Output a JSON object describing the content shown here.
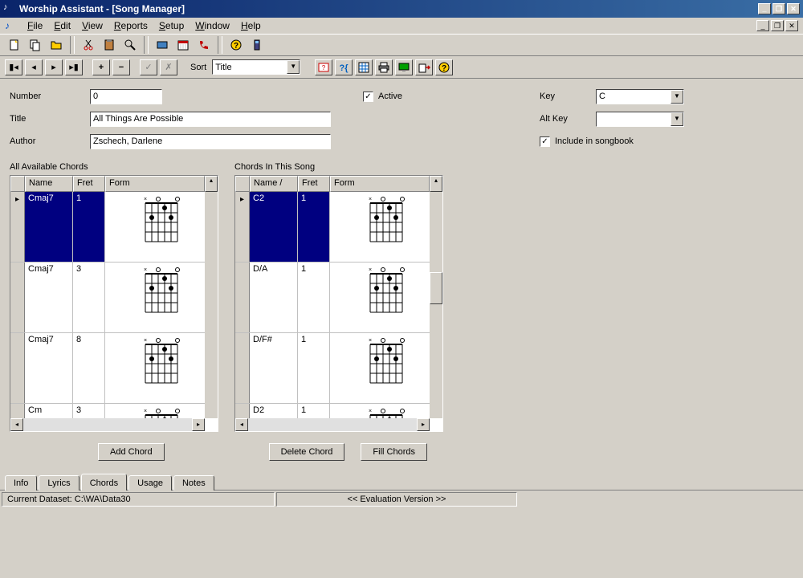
{
  "window": {
    "title": "Worship Assistant - [Song Manager]"
  },
  "menu": {
    "file": "File",
    "edit": "Edit",
    "view": "View",
    "reports": "Reports",
    "setup": "Setup",
    "window": "Window",
    "help": "Help"
  },
  "nav": {
    "sort_label": "Sort",
    "sort_value": "Title"
  },
  "form": {
    "number_label": "Number",
    "number_value": "0",
    "title_label": "Title",
    "title_value": "All Things Are Possible",
    "author_label": "Author",
    "author_value": "Zschech, Darlene",
    "active_label": "Active",
    "active_checked": true,
    "key_label": "Key",
    "key_value": "C",
    "altkey_label": "Alt Key",
    "altkey_value": "",
    "include_label": "Include in songbook",
    "include_checked": true
  },
  "left_panel": {
    "title": "All Available Chords",
    "headers": {
      "name": "Name",
      "fret": "Fret",
      "form": "Form"
    },
    "rows": [
      {
        "name": "Cmaj7",
        "fret": "1",
        "selected": true
      },
      {
        "name": "Cmaj7",
        "fret": "3",
        "selected": false
      },
      {
        "name": "Cmaj7",
        "fret": "8",
        "selected": false
      },
      {
        "name": "Cm",
        "fret": "3",
        "selected": false
      }
    ],
    "add_button": "Add Chord"
  },
  "right_panel": {
    "title": "Chords In This Song",
    "headers": {
      "name": "Name /",
      "fret": "Fret",
      "form": "Form"
    },
    "rows": [
      {
        "name": "C2",
        "fret": "1",
        "selected": true
      },
      {
        "name": "D/A",
        "fret": "1",
        "selected": false
      },
      {
        "name": "D/F#",
        "fret": "1",
        "selected": false
      },
      {
        "name": "D2",
        "fret": "1",
        "selected": false
      }
    ],
    "delete_button": "Delete Chord",
    "fill_button": "Fill Chords"
  },
  "tabs": {
    "info": "Info",
    "lyrics": "Lyrics",
    "chords": "Chords",
    "usage": "Usage",
    "notes": "Notes"
  },
  "status": {
    "dataset": "Current Dataset:  C:\\WA\\Data30",
    "eval": "<<  Evaluation Version  >>"
  }
}
